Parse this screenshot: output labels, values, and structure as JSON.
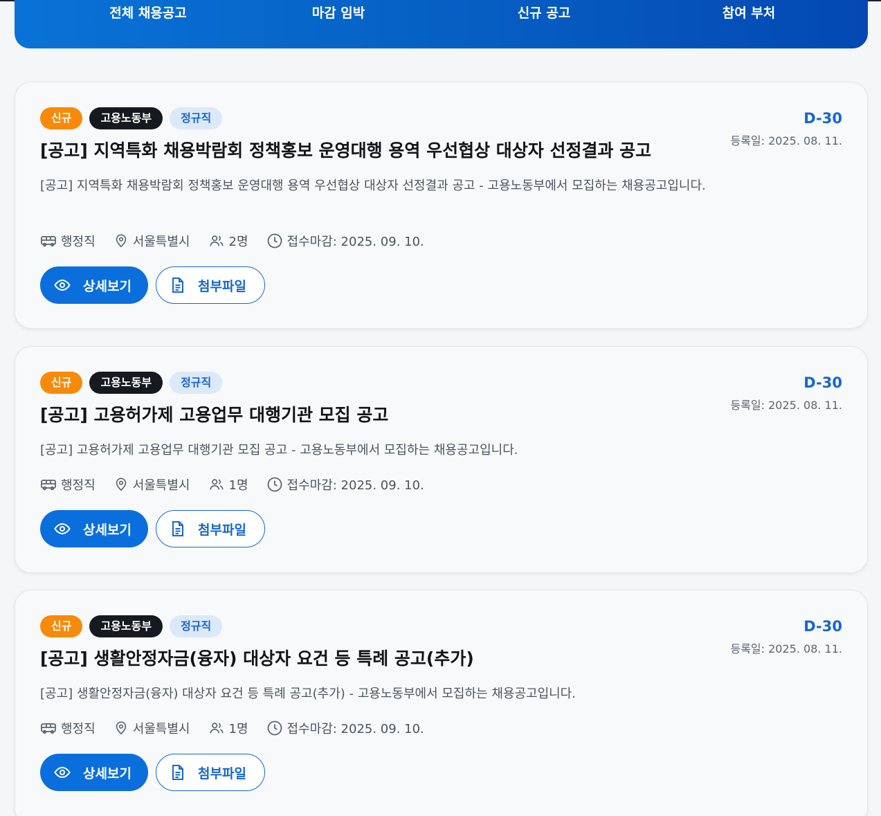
{
  "nav": {
    "items": [
      "전체 채용공고",
      "마감 임박",
      "신규 공고",
      "참여 부처"
    ]
  },
  "colors": {
    "nav_gradient_start": "#0a72d6",
    "nav_gradient_end": "#0448b3",
    "badge_new": "#f88a0a",
    "badge_org": "#16191f",
    "badge_type_bg": "#dce9fb",
    "accent": "#1566d2"
  },
  "jobs": [
    {
      "badges": {
        "new": "신규",
        "org": "고용노동부",
        "type": "정규직"
      },
      "dday": "D-30",
      "registered": "등록일: 2025. 08. 11.",
      "title": "[공고] 지역특화 채용박람회 정책홍보 운영대행 용역 우선협상 대상자 선정결과 공고",
      "description": "[공고] 지역특화 채용박람회 정책홍보 운영대행 용역 우선협상 대상자 선정결과 공고 - 고용노동부에서 모집하는 채용공고입니다.",
      "meta": {
        "category": "행정직",
        "location": "서울특별시",
        "headcount": "2명",
        "deadline": "접수마감: 2025. 09. 10."
      },
      "buttons": {
        "detail": "상세보기",
        "attachment": "첨부파일"
      }
    },
    {
      "badges": {
        "new": "신규",
        "org": "고용노동부",
        "type": "정규직"
      },
      "dday": "D-30",
      "registered": "등록일: 2025. 08. 11.",
      "title": "[공고] 고용허가제 고용업무 대행기관 모집 공고",
      "description": "[공고] 고용허가제 고용업무 대행기관 모집 공고 - 고용노동부에서 모집하는 채용공고입니다.",
      "meta": {
        "category": "행정직",
        "location": "서울특별시",
        "headcount": "1명",
        "deadline": "접수마감: 2025. 09. 10."
      },
      "buttons": {
        "detail": "상세보기",
        "attachment": "첨부파일"
      }
    },
    {
      "badges": {
        "new": "신규",
        "org": "고용노동부",
        "type": "정규직"
      },
      "dday": "D-30",
      "registered": "등록일: 2025. 08. 11.",
      "title": "[공고] 생활안정자금(융자) 대상자 요건 등 특례 공고(추가)",
      "description": "[공고] 생활안정자금(융자) 대상자 요건 등 특례 공고(추가) - 고용노동부에서 모집하는 채용공고입니다.",
      "meta": {
        "category": "행정직",
        "location": "서울특별시",
        "headcount": "1명",
        "deadline": "접수마감: 2025. 09. 10."
      },
      "buttons": {
        "detail": "상세보기",
        "attachment": "첨부파일"
      }
    }
  ]
}
